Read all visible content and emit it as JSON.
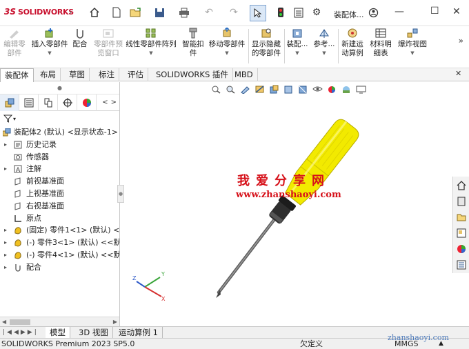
{
  "app": {
    "logo_ds": "3S",
    "logo_text": "SOLIDWORKS",
    "expand_arrow": "›",
    "doc_title": "装配体...",
    "search_icon": "search-icon"
  },
  "ribbon": {
    "items": [
      {
        "label1": "编辑零",
        "label2": "部件",
        "disabled": true,
        "icon": "edit-component-icon"
      },
      {
        "label1": "插入零部件",
        "label2": "",
        "dropdown": true,
        "icon": "insert-component-icon"
      },
      {
        "label1": "配合",
        "label2": "",
        "icon": "mate-icon"
      },
      {
        "label1": "零部件预",
        "label2": "览窗口",
        "disabled": true,
        "icon": "preview-window-icon"
      },
      {
        "label1": "线性零部件阵列",
        "label2": "",
        "dropdown": true,
        "icon": "linear-pattern-icon"
      },
      {
        "label1": "智能扣",
        "label2": "件",
        "icon": "smart-fastener-icon"
      },
      {
        "label1": "移动零部件",
        "label2": "",
        "dropdown": true,
        "icon": "move-component-icon"
      },
      {
        "label1": "显示隐藏",
        "label2": "的零部件",
        "icon": "show-hidden-icon"
      },
      {
        "label1": "装配...",
        "label2": "",
        "dropdown": true,
        "icon": "assembly-features-icon"
      },
      {
        "label1": "参考...",
        "label2": "",
        "dropdown": true,
        "icon": "reference-geometry-icon"
      },
      {
        "label1": "新建运",
        "label2": "动算例",
        "icon": "new-motion-study-icon"
      },
      {
        "label1": "材料明",
        "label2": "细表",
        "icon": "bom-icon"
      },
      {
        "label1": "爆炸视图",
        "label2": "",
        "dropdown": true,
        "icon": "exploded-view-icon"
      }
    ],
    "more": "»"
  },
  "tabs": [
    "装配体",
    "布局",
    "草图",
    "标注",
    "评估",
    "SOLIDWORKS 插件",
    "MBD"
  ],
  "tree": {
    "root": "装配体2 (默认) <显示状态-1>",
    "items": [
      {
        "label": "历史记录",
        "expand": true,
        "icon": "history-icon"
      },
      {
        "label": "传感器",
        "expand": false,
        "icon": "sensor-icon"
      },
      {
        "label": "注解",
        "expand": true,
        "icon": "annotation-icon"
      },
      {
        "label": "前视基准面",
        "expand": false,
        "icon": "plane-icon"
      },
      {
        "label": "上视基准面",
        "expand": false,
        "icon": "plane-icon"
      },
      {
        "label": "右视基准面",
        "expand": false,
        "icon": "plane-icon"
      },
      {
        "label": "原点",
        "expand": false,
        "icon": "origin-icon"
      },
      {
        "label": "(固定) 零件1<1> (默认) <<",
        "expand": true,
        "icon": "part-icon"
      },
      {
        "label": "(-) 零件3<1> (默认) <<默认",
        "expand": true,
        "icon": "part-icon"
      },
      {
        "label": "(-) 零件4<1> (默认) <<默认",
        "expand": true,
        "icon": "part-icon"
      },
      {
        "label": "配合",
        "expand": true,
        "icon": "mates-folder-icon"
      }
    ]
  },
  "bottom_tabs": [
    "模型",
    "3D 视图",
    "运动算例 1"
  ],
  "status": {
    "product": "SOLIDWORKS Premium 2023 SP5.0",
    "state": "欠定义",
    "units": "MMGS",
    "units_arrow": "▲"
  },
  "watermark": {
    "cn": "我爱分享网",
    "url": "www.zhanshaoyi.com",
    "bottom_url": "zhanshaoyi.com"
  },
  "triad": {
    "x": "X",
    "y": "Y",
    "z": "Z"
  },
  "colors": {
    "brand_red": "#c8102e",
    "screwdriver_handle": "#f2ea00",
    "screwdriver_shaft": "#6b6b6b",
    "watermark_red": "#d6111a"
  }
}
